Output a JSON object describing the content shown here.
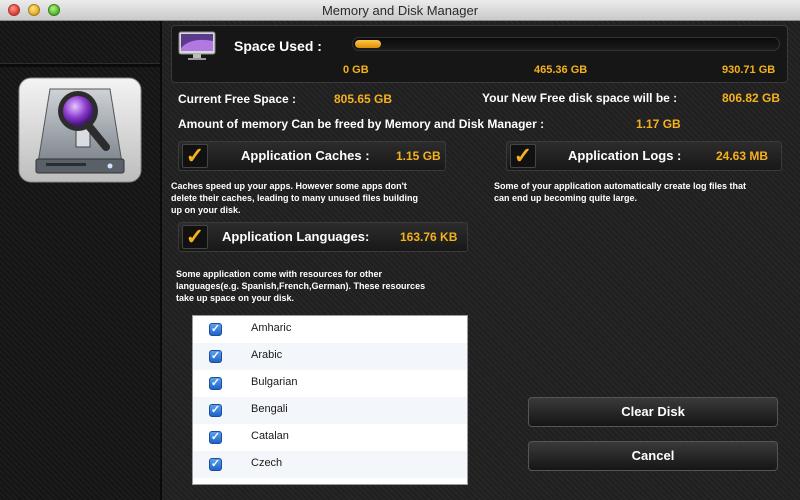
{
  "window": {
    "title": "Memory and Disk Manager"
  },
  "space": {
    "label": "Space Used :",
    "used_fraction": 0.062,
    "scale_min": "0 GB",
    "scale_mid": "465.36 GB",
    "scale_max": "930.71 GB"
  },
  "stats": {
    "current_free_label": "Current Free Space :",
    "current_free_value": "805.65 GB",
    "new_free_label": "Your New Free disk space will be :",
    "new_free_value": "806.82 GB",
    "freed_label": "Amount of memory Can be freed by Memory and Disk Manager :",
    "freed_value": "1.17 GB"
  },
  "caches": {
    "label": "Application Caches :",
    "value": "1.15 GB",
    "checked": true,
    "desc": [
      "Caches speed up your apps. However some apps don't",
      "delete their caches, leading to many unused files building",
      "up on your disk."
    ]
  },
  "logs": {
    "label": "Application Logs :",
    "value": "24.63 MB",
    "checked": true,
    "desc": [
      "Some of your application automatically create log files that",
      "can end up becoming quite large."
    ]
  },
  "languages": {
    "label": "Application Languages:",
    "value": "163.76 KB",
    "checked": true,
    "desc": [
      "Some application come with resources for other",
      "languages(e.g. Spanish,French,German). These resources",
      "take up space on your disk."
    ],
    "items": [
      {
        "name": "Amharic",
        "checked": true
      },
      {
        "name": "Arabic",
        "checked": true
      },
      {
        "name": "Bulgarian",
        "checked": true
      },
      {
        "name": "Bengali",
        "checked": true
      },
      {
        "name": "Catalan",
        "checked": true
      },
      {
        "name": "Czech",
        "checked": true
      }
    ]
  },
  "buttons": {
    "clear": "Clear Disk",
    "cancel": "Cancel"
  },
  "colors": {
    "accent": "#f5b11c",
    "text": "#ffffff",
    "checkbox_blue": "#2f7be0"
  },
  "icons": {
    "app": "hard-drive-magnifier-icon",
    "monitor": "monitor-icon",
    "check": "checkmark-icon"
  }
}
